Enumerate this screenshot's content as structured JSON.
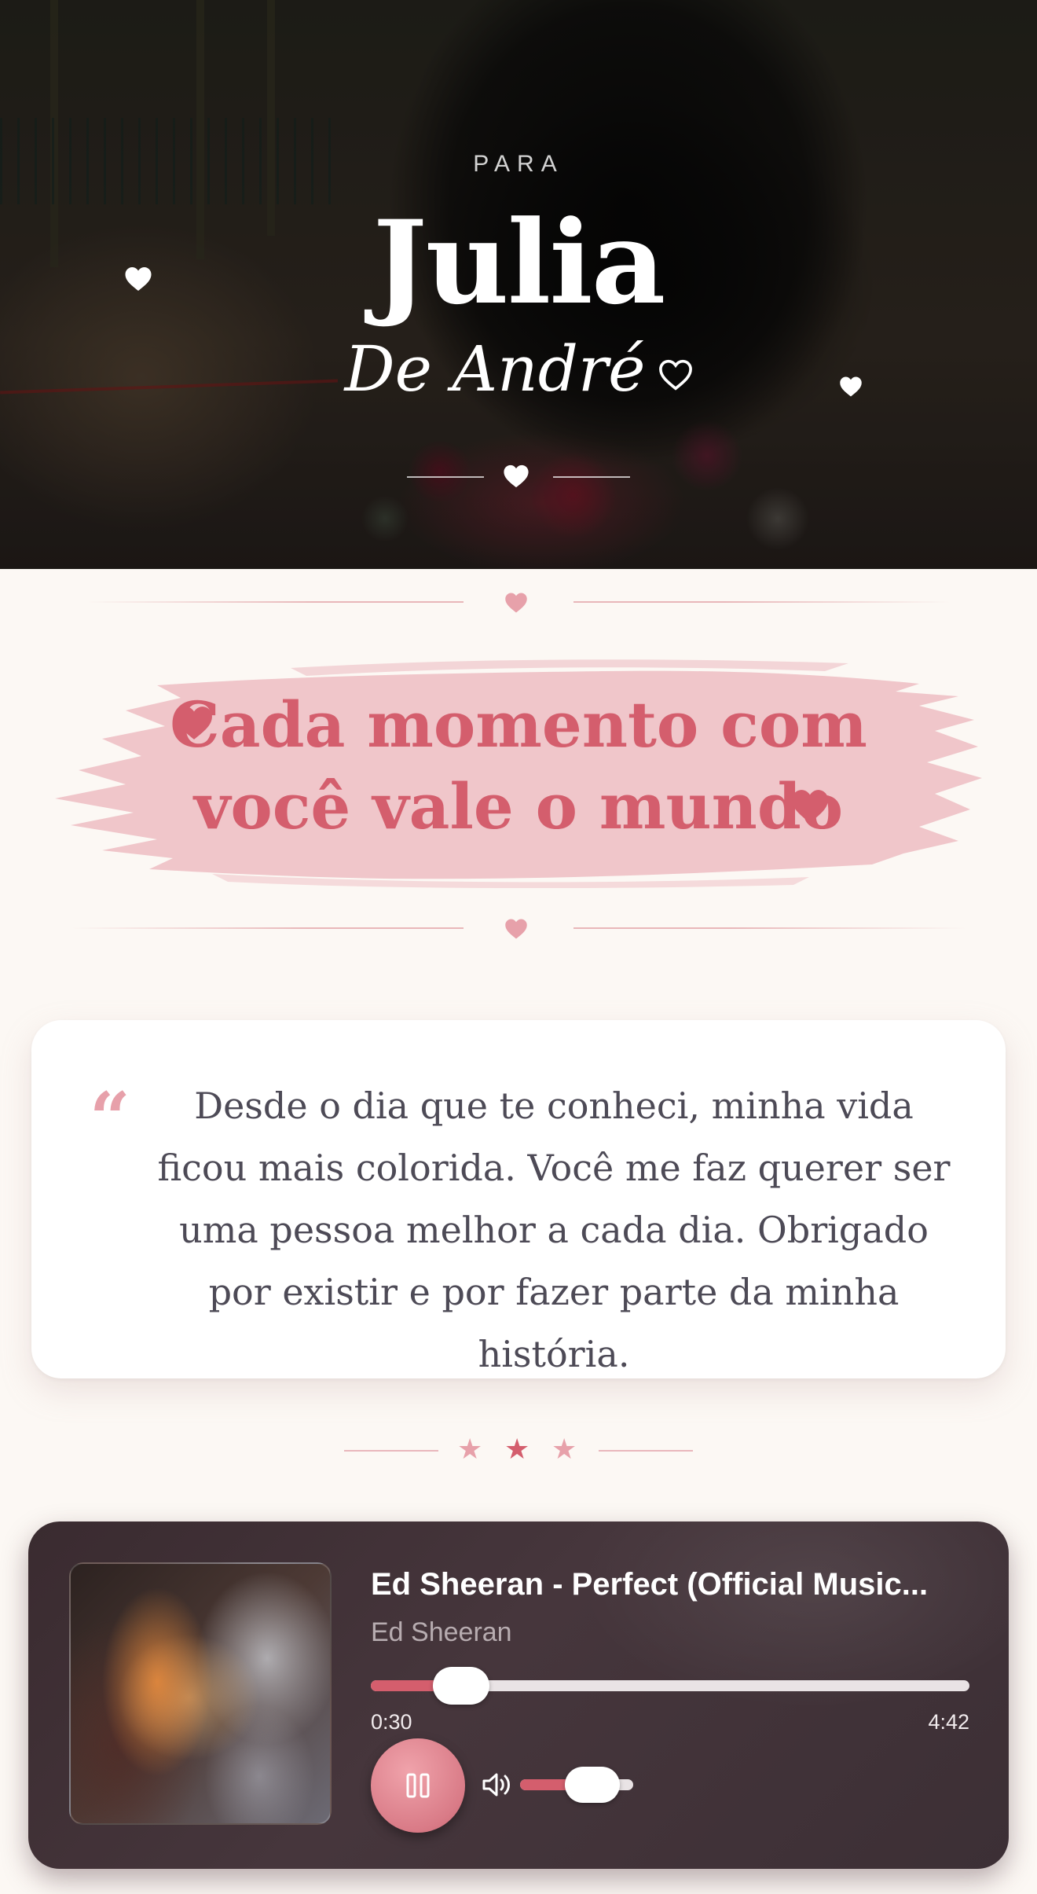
{
  "hero": {
    "para_label": "PARA",
    "name": "Julia",
    "from": "De André",
    "decor_icons": [
      "heart-icon",
      "outline-heart-icon"
    ]
  },
  "banner": {
    "line1": "Cada momento com",
    "line2": "você vale o mundo",
    "brush_color": "#f0c6ca",
    "text_color": "#d45e6d"
  },
  "letter": {
    "quote_mark": "“",
    "text": "Desde o dia que te conheci, minha vida ficou mais colorida. Você me faz querer ser uma pessoa melhor a cada dia. Obrigado por existir e por fazer parte da minha história."
  },
  "stars_divider": {
    "icons": [
      "star-icon",
      "star-icon",
      "star-icon"
    ],
    "glyph": "★"
  },
  "player": {
    "title": "Ed Sheeran - Perfect (Official Music...",
    "artist": "Ed Sheeran",
    "current_time": "0:30",
    "total_time": "4:42",
    "progress_fraction": 0.106,
    "volume_fraction": 0.5,
    "state": "playing",
    "accent_color": "#d45e6d"
  }
}
